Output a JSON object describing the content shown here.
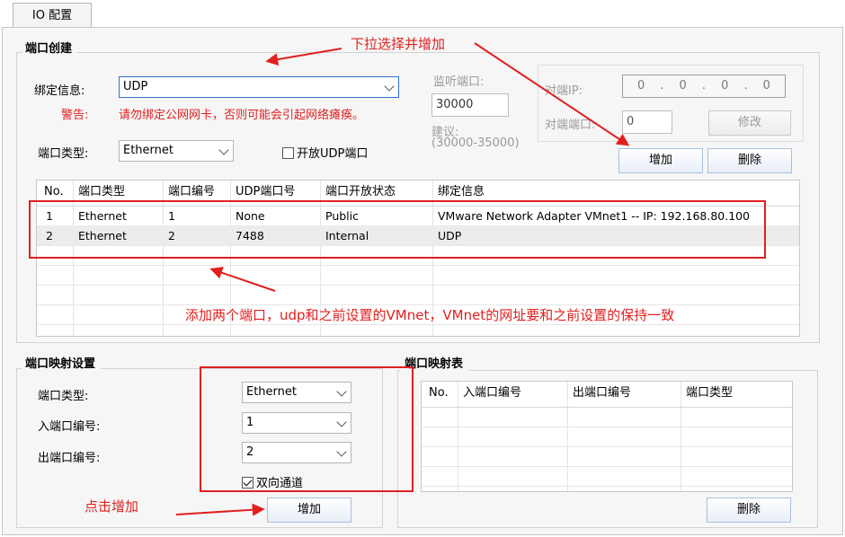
{
  "tab": {
    "label": "IO 配置"
  },
  "port_create": {
    "title": "端口创建",
    "bind_label": "绑定信息:",
    "bind_value": "UDP",
    "warning_label": "警告:",
    "warning_text": "请勿绑定公网网卡，否则可能会引起网络瘫痪。",
    "type_label": "端口类型:",
    "type_value": "Ethernet",
    "open_udp_label": "开放UDP端口",
    "listen_label": "监听端口:",
    "listen_value": "30000",
    "suggest_label": "建议:",
    "suggest_range": "(30000-35000)",
    "peer_ip_label": "对端IP:",
    "peer_ip_parts": [
      "0",
      ".",
      "0",
      ".",
      "0",
      ".",
      "0"
    ],
    "peer_port_label": "对端端口:",
    "peer_port_value": "0",
    "modify_label": "修改",
    "add_label": "增加",
    "delete_label": "删除",
    "columns": [
      "No.",
      "端口类型",
      "端口编号",
      "UDP端口号",
      "端口开放状态",
      "绑定信息"
    ],
    "rows": [
      [
        "1",
        "Ethernet",
        "1",
        "None",
        "Public",
        "VMware Network Adapter VMnet1 -- IP: 192.168.80.100"
      ],
      [
        "2",
        "Ethernet",
        "2",
        "7488",
        "Internal",
        "UDP"
      ]
    ]
  },
  "port_map_settings": {
    "title": "端口映射设置",
    "type_label": "端口类型:",
    "type_value": "Ethernet",
    "in_label": "入端口编号:",
    "in_value": "1",
    "out_label": "出端口编号:",
    "out_value": "2",
    "bidir_label": "双向通道",
    "add_label": "增加"
  },
  "port_map_table": {
    "title": "端口映射表",
    "columns": [
      "No.",
      "入端口编号",
      "出端口编号",
      "端口类型"
    ],
    "delete_label": "删除"
  },
  "annotations": {
    "dropdown_hint": "下拉选择并增加",
    "add_two_ports": "添加两个端口，udp和之前设置的VMnet，VMnet的网址要和之前设置的保持一致",
    "click_add": "点击增加"
  },
  "colors": {
    "annotation": "#e02020",
    "focus_border": "#2f6fd0"
  }
}
